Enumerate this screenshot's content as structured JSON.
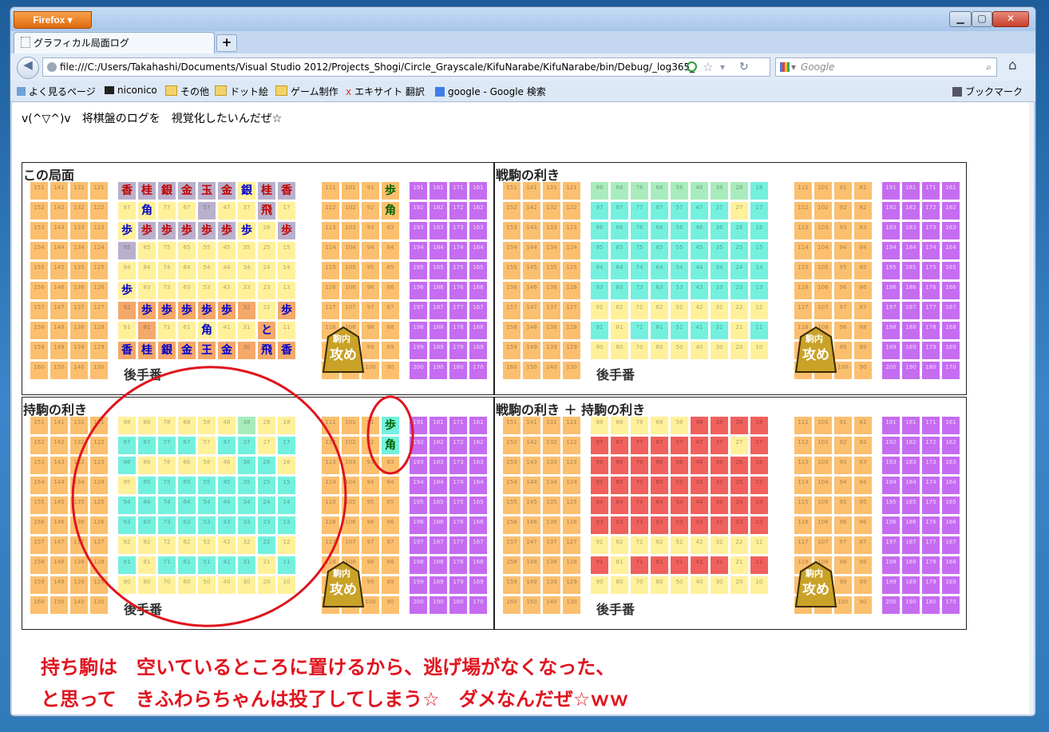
{
  "browser": {
    "menu_label": "Firefox ▾",
    "tab_title": "グラフィカル局面ログ",
    "new_tab_label": "+",
    "url": "file:///C:/Users/Takahashi/Documents/Visual Studio 2012/Projects_Shogi/Circle_Grayscale/KifuNarabe/KifuNarabe/bin/Debug/_log365_",
    "search_placeholder": "Google",
    "bookmarks": [
      "よく見るページ",
      "niconico",
      "その他",
      "ドット絵",
      "ゲーム制作",
      "エキサイト 翻訳",
      "google - Google 検索"
    ],
    "bookmarks_menu": "ブックマーク"
  },
  "page": {
    "intro": "v(^▽^)v　将棋盤のログを　視覚化したいんだぜ☆",
    "seme_label": "攻め",
    "seme_small": "駒内",
    "gote_label": "後手番",
    "panels": [
      {
        "title": "この局面"
      },
      {
        "title": "戦駒の利き"
      },
      {
        "title": "持駒の利き"
      },
      {
        "title": "戦駒の利き ＋ 持駒の利き"
      }
    ],
    "hand_pieces": [
      "歩",
      "角"
    ],
    "board_rows": [
      [
        "香",
        "桂",
        "銀",
        "金",
        "王",
        "金",
        "",
        "飛",
        "香"
      ],
      [
        "",
        "",
        "",
        "",
        "角",
        "",
        "",
        "と",
        ""
      ],
      [
        "",
        "歩",
        "歩",
        "歩",
        "歩",
        "歩",
        "",
        "",
        "歩"
      ],
      [
        "歩",
        "",
        "",
        "",
        "",
        "",
        "",
        "",
        ""
      ],
      [
        "",
        "",
        "",
        "",
        "",
        "",
        "",
        "",
        ""
      ],
      [
        "",
        "",
        "",
        "",
        "",
        "",
        "",
        "",
        ""
      ],
      [
        "歩",
        "歩",
        "歩",
        "歩",
        "歩",
        "歩",
        "歩",
        "",
        "歩"
      ],
      [
        "",
        "角",
        "",
        "",
        "",
        "",
        "",
        "飛",
        ""
      ],
      [
        "香",
        "桂",
        "銀",
        "金",
        "玉",
        "金",
        "銀",
        "桂",
        "香"
      ]
    ],
    "board_sides": [
      [
        "e",
        "e",
        "e",
        "e",
        "e",
        "e",
        "",
        "e",
        "e"
      ],
      [
        "",
        "",
        "",
        "",
        "e",
        "",
        "",
        "e",
        ""
      ],
      [
        "",
        "e",
        "e",
        "e",
        "e",
        "e",
        "",
        "",
        "e"
      ],
      [
        "e",
        "",
        "",
        "",
        "",
        "",
        "",
        "",
        ""
      ],
      [
        "",
        "",
        "",
        "",
        "",
        "",
        "",
        "",
        ""
      ],
      [
        "",
        "",
        "",
        "",
        "",
        "",
        "",
        "",
        ""
      ],
      [
        "m",
        "m",
        "m",
        "m",
        "m",
        "m",
        "m",
        "",
        "m"
      ],
      [
        "",
        "m",
        "",
        "",
        "",
        "",
        "",
        "m",
        ""
      ],
      [
        "m",
        "m",
        "m",
        "m",
        "m",
        "m",
        "m",
        "m",
        "m"
      ]
    ],
    "message_line1": "持ち駒は　空いているところに置けるから、逃げ場がなくなった、",
    "message_line2": "と思って　きふわらちゃんは投了してしまう☆　ダメなんだぜ☆ｗｗ"
  },
  "colors": {
    "orange": "#fbbf6e",
    "yellow": "#fff09a",
    "purple": "#c56cf0",
    "cyan": "#74f0de",
    "green": "#a8ecbc",
    "red": "#f0605c",
    "enemy_bg": "#b9b0cc",
    "mine_bg": "#f4a86a",
    "annotation_red": "#e0141e"
  }
}
